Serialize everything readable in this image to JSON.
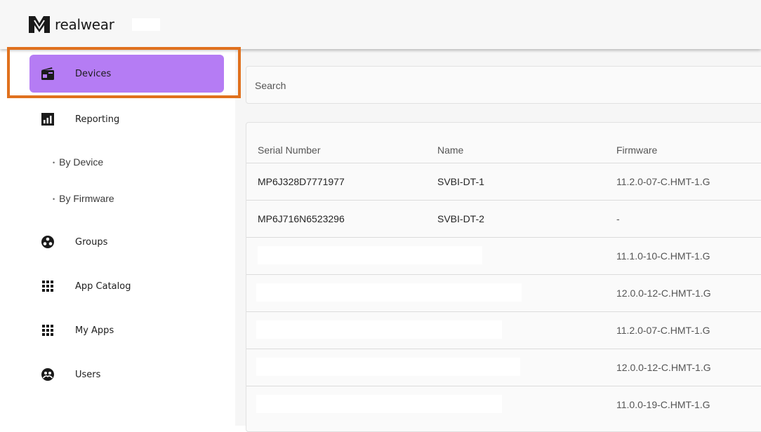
{
  "brand": {
    "name": "realwear"
  },
  "sidebar": {
    "items": [
      {
        "label": "Devices",
        "icon": "radio-device-icon",
        "active": true
      },
      {
        "label": "Reporting",
        "icon": "bar-chart-icon"
      },
      {
        "label": "Groups",
        "icon": "groups-icon"
      },
      {
        "label": "App Catalog",
        "icon": "grid-icon"
      },
      {
        "label": "My Apps",
        "icon": "grid-icon"
      },
      {
        "label": "Users",
        "icon": "users-icon"
      }
    ],
    "subitems": [
      {
        "label": "By Device"
      },
      {
        "label": "By Firmware"
      }
    ]
  },
  "search": {
    "placeholder": "Search"
  },
  "table": {
    "columns": [
      "Serial Number",
      "Name",
      "Firmware"
    ],
    "rows": [
      {
        "serial": "MP6J328D7771977",
        "name": "SVBI-DT-1",
        "firmware": "11.2.0-07-C.HMT-1.G"
      },
      {
        "serial": "MP6J716N6523296",
        "name": "SVBI-DT-2",
        "firmware": "-"
      },
      {
        "serial": "",
        "name": "",
        "firmware": "11.1.0-10-C.HMT-1.G"
      },
      {
        "serial": "",
        "name": "",
        "firmware": "12.0.0-12-C.HMT-1.G"
      },
      {
        "serial": "",
        "name": "",
        "firmware": "11.2.0-07-C.HMT-1.G"
      },
      {
        "serial": "",
        "name": "",
        "firmware": "12.0.0-12-C.HMT-1.G"
      },
      {
        "serial": "",
        "name": "",
        "firmware": "11.0.0-19-C.HMT-1.G"
      }
    ]
  },
  "colors": {
    "active_nav": "#b57cf4",
    "highlight_border": "#e0711e"
  }
}
